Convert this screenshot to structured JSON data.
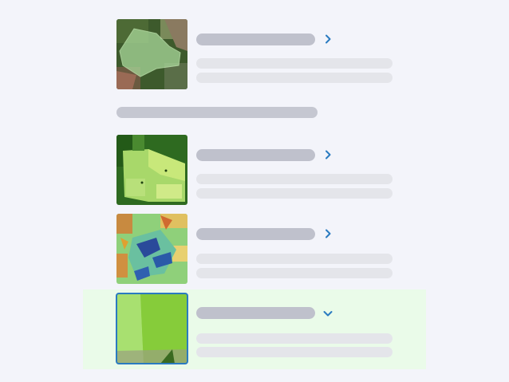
{
  "accent_color": "#2a7bc0",
  "selected_bg_color": "#eafbe9",
  "sections": [
    {
      "items": [
        {
          "thumbnail": "satellite-field-thumbnail",
          "expand_icon": "chevron-right-icon",
          "expanded": false
        }
      ]
    },
    {
      "header_placeholder": true,
      "items": [
        {
          "thumbnail": "vegetation-index-thumbnail",
          "expand_icon": "chevron-right-icon",
          "expanded": false
        },
        {
          "thumbnail": "moisture-map-thumbnail",
          "expand_icon": "chevron-right-icon",
          "expanded": false
        },
        {
          "thumbnail": "green-field-thumbnail",
          "expand_icon": "chevron-down-icon",
          "expanded": true,
          "selected": true
        }
      ]
    }
  ]
}
